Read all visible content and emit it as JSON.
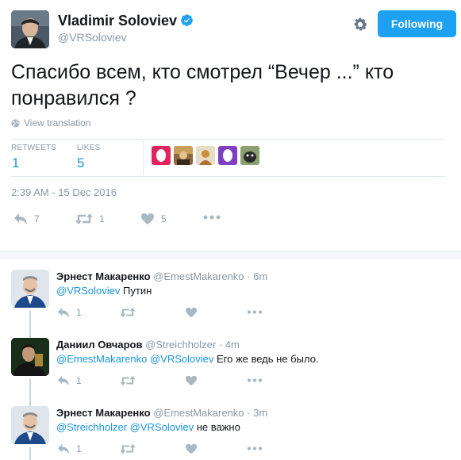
{
  "tweet": {
    "name": "Vladimir Soloviev",
    "handle": "@VRSoloviev",
    "follow_label": "Following",
    "text": "Спасибо всем, кто смотрел “Вечер ...” кто понравился ?",
    "translate_label": "View translation",
    "retweets_label": "RETWEETS",
    "retweets_value": "1",
    "likes_label": "LIKES",
    "likes_value": "5",
    "timestamp": "2:39 AM - 15 Dec 2016",
    "reply_count": "7",
    "retweet_count": "1",
    "like_count": "5"
  },
  "replies": [
    {
      "name": "Эрнест Макаренко",
      "handle": "@EmestMakarenko · 6m",
      "mentions": "@VRSoloviev",
      "text": " Путин",
      "reply_count": "1"
    },
    {
      "name": "Даниил Овчаров",
      "handle": "@Streichholzer · 4m",
      "mentions": "@EmestMakarenko @VRSoloviev",
      "text": " Его же ведь не было.",
      "reply_count": "1"
    },
    {
      "name": "Эрнест Макаренко",
      "handle": "@EmestMakarenko · 3m",
      "mentions": "@Streichholzer @VRSoloviev",
      "text": " не важно",
      "reply_count": "1"
    }
  ],
  "colors": {
    "accent": "#1da1f2",
    "link": "#1b95e0",
    "muted": "#8899a6",
    "like_pink": "#e0245e"
  },
  "icons": [
    "verified-badge-icon",
    "gear-icon",
    "globe-icon",
    "reply-icon",
    "retweet-icon",
    "heart-icon",
    "more-icon"
  ]
}
